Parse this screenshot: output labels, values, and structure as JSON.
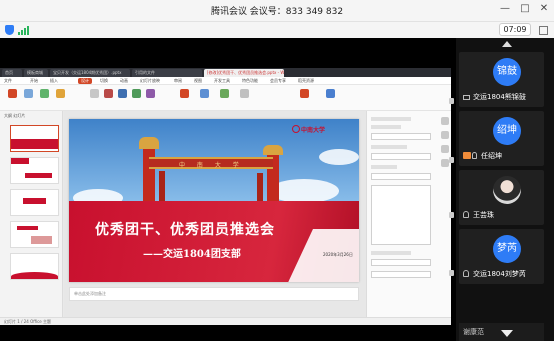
{
  "window": {
    "title": "腾讯会议 会议号：833 349 832",
    "min": "—",
    "max": "□",
    "close": "✕"
  },
  "status": {
    "timer": "07:09"
  },
  "shared_screen": {
    "tabs": [
      "首页",
      "模板商城",
      "宝贝开发（交运1804期优秀团）.pptx",
      "引用的文件",
      "[修改]优秀团干、优秀团员推选会.pptx - WPS"
    ],
    "menu": [
      "文件",
      "开始",
      "插入",
      "设计",
      "切换",
      "动画",
      "幻灯片放映",
      "审阅",
      "视图",
      "开发工具",
      "特色功能",
      "会员专享",
      "稻壳资源"
    ],
    "active_menu": "设计",
    "thumb_header": "大纲 幻灯片",
    "slide": {
      "logo_text": "中南大学",
      "arch_text": "中 南 大 学",
      "headline": "优秀团干、优秀团员推选会",
      "subline": "——交运1804团支部",
      "date": "2020年3月26日"
    },
    "notes_placeholder": "单击此处添加备注",
    "statusbar": "幻灯片 1 / 24   Office 主题"
  },
  "participants": [
    {
      "initials": "锦鼓",
      "name": "交运1804熊锦鼓",
      "avatar_color": "#2e7cf6"
    },
    {
      "initials": "绍坤",
      "name": "任绍坤",
      "avatar_color": "#2e7cf6"
    },
    {
      "initials": "",
      "name": "王芸珠",
      "avatar_color": "#eeeeee"
    },
    {
      "initials": "梦芮",
      "name": "交运1804刘梦芮",
      "avatar_color": "#2e7cf6"
    },
    {
      "initials": "",
      "name": "谢康范",
      "avatar_color": "#1c1c1c"
    }
  ]
}
